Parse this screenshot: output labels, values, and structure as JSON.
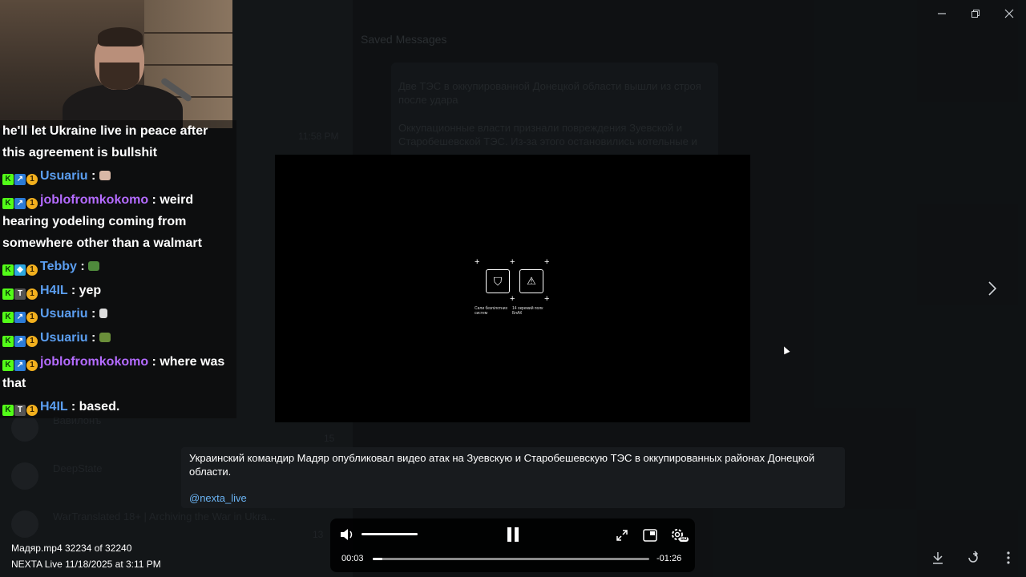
{
  "window": {
    "minimize_icon": "minimize-icon",
    "maximize_icon": "restore-icon",
    "close_icon": "close-icon"
  },
  "background": {
    "chat_title": "Saved Messages",
    "message_lines": [
      "Две ТЭС в оккупированной Донецкой области вышли из строя после удара",
      "Оккупационные власти признали повреждения Зуевской и Старобешевской ТЭС. Из-за этого остановились котельные и"
    ],
    "time_label": "11:58 PM",
    "rows": [
      {
        "name": "Вавилонъ",
        "sub": "",
        "badge": "15"
      },
      {
        "name": "DeepState",
        "sub": "",
        "badge": ""
      },
      {
        "name": "WarTranslated 18+ | Archiving the War in Ukra...",
        "sub": "",
        "badge": "13"
      }
    ]
  },
  "stream_chat": {
    "lines": [
      {
        "user": "",
        "text": "he'll let Ukraine live in peace after this agreement is bullshit",
        "color": ""
      },
      {
        "user": "Usuariu",
        "text": "",
        "color": "#5b9ef0"
      },
      {
        "user": "joblofromkokomo",
        "text": "weird hearing yodeling coming from somewhere other than a walmart",
        "color": "#b46bff"
      },
      {
        "user": "Tebby",
        "text": "",
        "color": "#5b9ef0"
      },
      {
        "user": "H4IL",
        "text": "yep",
        "color": "#5b9ef0"
      },
      {
        "user": "Usuariu",
        "text": "",
        "color": "#5b9ef0"
      },
      {
        "user": "Usuariu",
        "text": "",
        "color": "#5b9ef0"
      },
      {
        "user": "joblofromkokomo",
        "text": "where was that",
        "color": "#b46bff"
      },
      {
        "user": "H4IL",
        "text": "based.",
        "color": "#5b9ef0"
      }
    ]
  },
  "video": {
    "logo_caption_1": "Сили безпілотних систем",
    "logo_caption_2": "14 окремий полк БпАК"
  },
  "caption": {
    "text": "Украинский командир Мадяр опубликовал видео атак на Зуевскую и Старобешевскую ТЭС в оккупированных районах Донецкой области.",
    "link": "@nexta_live"
  },
  "player": {
    "current_time": "00:03",
    "remaining_time": "-01:26",
    "progress_percent": 3.4,
    "volume_percent": 100,
    "quality_badge": "SD",
    "volume_icon": "volume-icon",
    "pause_icon": "pause-icon",
    "fullscreen_icon": "fullscreen-icon",
    "pip_icon": "picture-in-picture-icon",
    "settings_icon": "settings-icon"
  },
  "file_info": {
    "filename_line": "Мадяр.mp4 32234 of 32240",
    "source_line": "NEXTA Live   11/18/2025 at 3:11 PM"
  },
  "corner_controls": {
    "download_icon": "download-icon",
    "forward_icon": "forward-icon",
    "more_icon": "more-icon"
  },
  "colors": {
    "link": "#6ab3f3",
    "username_blue": "#5b9ef0",
    "username_purple": "#b46bff",
    "kick_green": "#53fc18"
  }
}
